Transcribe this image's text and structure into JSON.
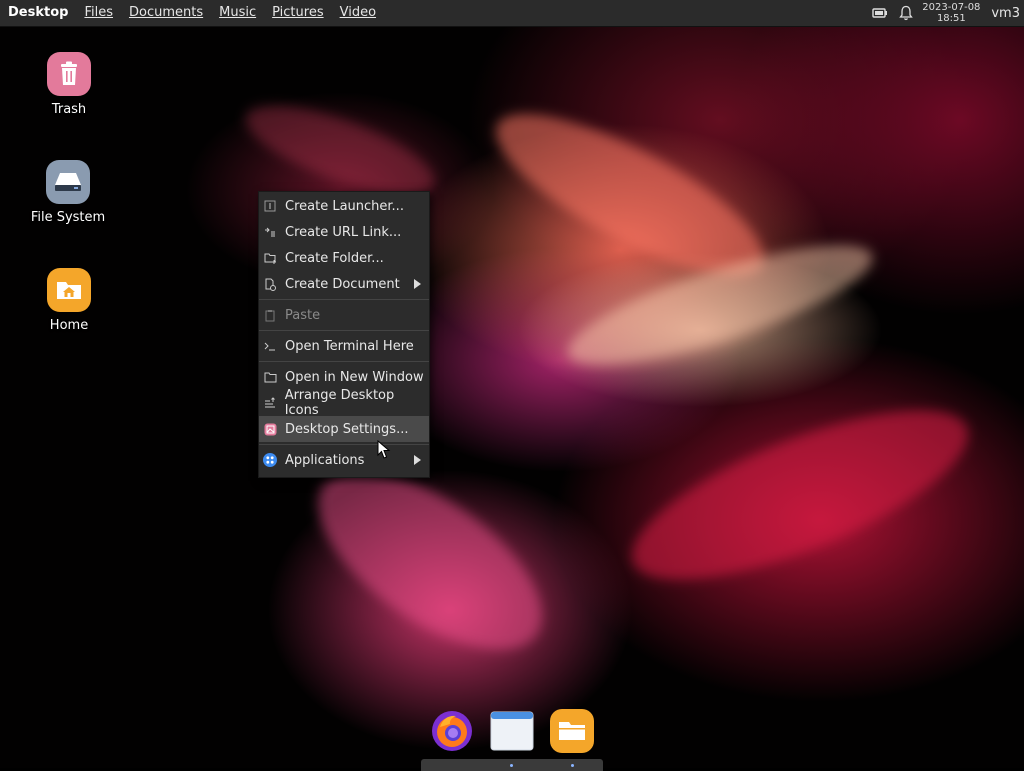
{
  "topbar": {
    "menus": [
      {
        "label": "Desktop",
        "active": true
      },
      {
        "label": "Files",
        "active": false
      },
      {
        "label": "Documents",
        "active": false
      },
      {
        "label": "Music",
        "active": false
      },
      {
        "label": "Pictures",
        "active": false
      },
      {
        "label": "Video",
        "active": false
      }
    ],
    "tray_icons": [
      "battery-icon",
      "notification-bell-icon"
    ],
    "date": "2023-07-08",
    "time": "18:51",
    "user": "vm3"
  },
  "desktop_icons": [
    {
      "label": "Trash",
      "icon": "trash-icon",
      "color": "#e37a9b"
    },
    {
      "label": "File System",
      "icon": "drive-icon",
      "color": "#8a9bb0"
    },
    {
      "label": "Home",
      "icon": "home-folder-icon",
      "color": "#f4a62a"
    }
  ],
  "context_menu": {
    "items": [
      {
        "label": "Create Launcher...",
        "icon": "launcher-icon",
        "disabled": false,
        "submenu": false
      },
      {
        "label": "Create URL Link...",
        "icon": "link-icon",
        "disabled": false,
        "submenu": false
      },
      {
        "label": "Create Folder...",
        "icon": "new-folder-icon",
        "disabled": false,
        "submenu": false
      },
      {
        "label": "Create Document",
        "icon": "new-document-icon",
        "disabled": false,
        "submenu": true
      },
      {
        "label": "Paste",
        "icon": "paste-icon",
        "disabled": true,
        "submenu": false
      },
      {
        "label": "Open Terminal Here",
        "icon": "terminal-icon",
        "disabled": false,
        "submenu": false
      },
      {
        "label": "Open in New Window",
        "icon": "folder-window-icon",
        "disabled": false,
        "submenu": false
      },
      {
        "label": "Arrange Desktop Icons",
        "icon": "arrange-icon",
        "disabled": false,
        "submenu": false
      },
      {
        "label": "Desktop Settings...",
        "icon": "desktop-settings-icon",
        "disabled": false,
        "submenu": false,
        "hover": true
      },
      {
        "label": "Applications",
        "icon": "applications-icon",
        "disabled": false,
        "submenu": true
      }
    ]
  },
  "dock": [
    {
      "app": "firefox-icon",
      "color": "#7b2fd1"
    },
    {
      "app": "window-icon",
      "color": "#e9eef5"
    },
    {
      "app": "files-icon",
      "color": "#f4a62a"
    }
  ]
}
